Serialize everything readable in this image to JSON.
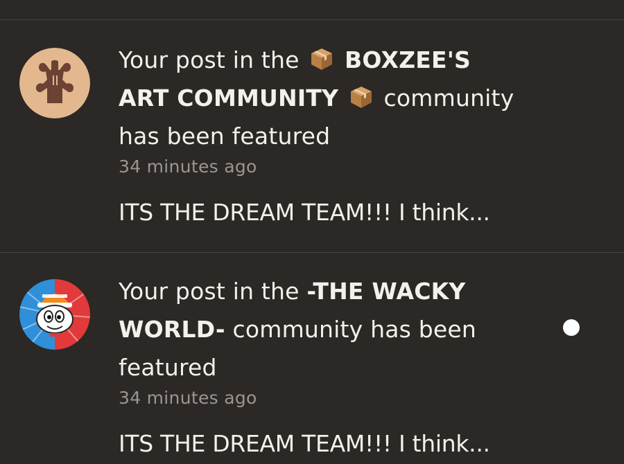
{
  "notifications": [
    {
      "prefix": "Your post in the",
      "community_part1": "BOXZEE'S",
      "community_part2": "ART COMMUNITY",
      "suffix": "community",
      "suffix2": "has been featured",
      "emoji_icon": "package-box-icon",
      "time": "34 minutes ago",
      "preview": "ITS THE DREAM TEAM!!! I think...",
      "avatar_icon": "brown-figure-avatar",
      "unread": false
    },
    {
      "prefix": "Your post in the",
      "community_part1": "-THE WACKY",
      "community_part2": "WORLD-",
      "suffix": "community has been",
      "suffix2": "featured",
      "time": "34 minutes ago",
      "preview": "ITS THE DREAM TEAM!!! I think...",
      "avatar_icon": "cartoon-character-avatar",
      "unread": true
    }
  ],
  "colors": {
    "background": "#2b2826",
    "text": "#f4f1ec",
    "muted": "#9b9692",
    "divider": "#4a4643"
  }
}
